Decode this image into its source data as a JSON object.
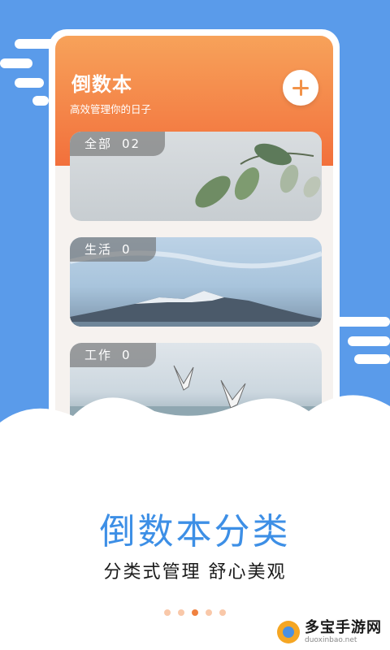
{
  "app": {
    "title": "倒数本",
    "subtitle": "高效管理你的日子",
    "add_button_icon": "plus-icon"
  },
  "categories": [
    {
      "label": "全部",
      "count": "02"
    },
    {
      "label": "生活",
      "count": "0"
    },
    {
      "label": "工作",
      "count": "0"
    }
  ],
  "caption": {
    "title": "倒数本分类",
    "subtitle": "分类式管理 舒心美观"
  },
  "pagination": {
    "total": 5,
    "active_index": 2
  },
  "watermark": {
    "name": "多宝手游网",
    "url": "duoxinbao.net"
  },
  "colors": {
    "background_blue": "#5a9bea",
    "header_orange": "#f2703c",
    "accent_blue_text": "#3d8fe6",
    "dot_active": "#f0813f",
    "dot_inactive": "#f9c8a9"
  }
}
